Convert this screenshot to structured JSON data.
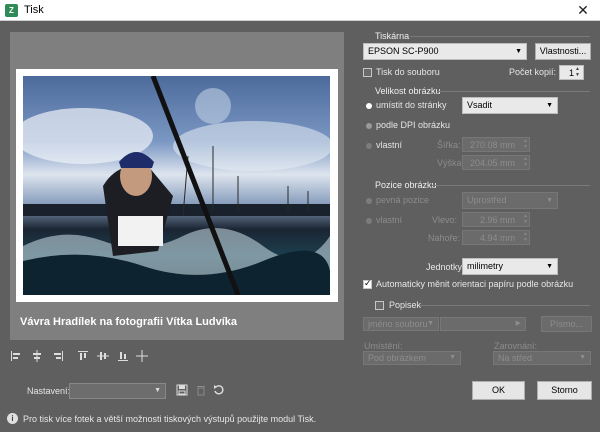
{
  "window": {
    "title": "Tisk",
    "app_icon_letter": "Z"
  },
  "preview": {
    "caption": "Vávra Hradílek na fotografii Vítka Ludvíka"
  },
  "printer": {
    "section_label": "Tiskárna",
    "selected": "EPSON SC-P900",
    "properties_button": "Vlastnosti...",
    "print_to_file_label": "Tisk do souboru",
    "copies_label": "Počet kopií:",
    "copies_value": "1"
  },
  "image_size": {
    "section_label": "Velikost obrázku",
    "fit_page_label": "umístit do stránky",
    "fit_mode": "Vsadit",
    "dpi_label": "podle DPI obrázku",
    "custom_label": "vlastní",
    "width_label": "Šířka:",
    "width_value": "270.08 mm",
    "height_label": "Výška:",
    "height_value": "204.05 mm"
  },
  "image_position": {
    "section_label": "Pozice obrázku",
    "fixed_label": "pevná pozice",
    "fixed_value": "Uprostřed",
    "custom_label": "vlastní",
    "left_label": "Vlevo:",
    "left_value": "2.96 mm",
    "top_label": "Nahoře:",
    "top_value": "4.94 mm"
  },
  "units": {
    "label": "Jednotky:",
    "value": "milimetry"
  },
  "auto_orient_label": "Automaticky měnit orientaci papíru podle obrázku",
  "caption_section": {
    "label": "Popisek",
    "source_value": "jméno souboru",
    "font_button": "Písmo...",
    "placement_label": "Umístění:",
    "placement_value": "Pod obrázkem",
    "alignment_label": "Zarovnání:",
    "alignment_value": "Na střed"
  },
  "presets": {
    "label": "Nastavení:",
    "value": ""
  },
  "buttons": {
    "ok": "OK",
    "cancel": "Storno"
  },
  "footer": {
    "info_text": "Pro tisk více fotek a větší možnosti tiskových výstupů použijte modul Tisk."
  }
}
